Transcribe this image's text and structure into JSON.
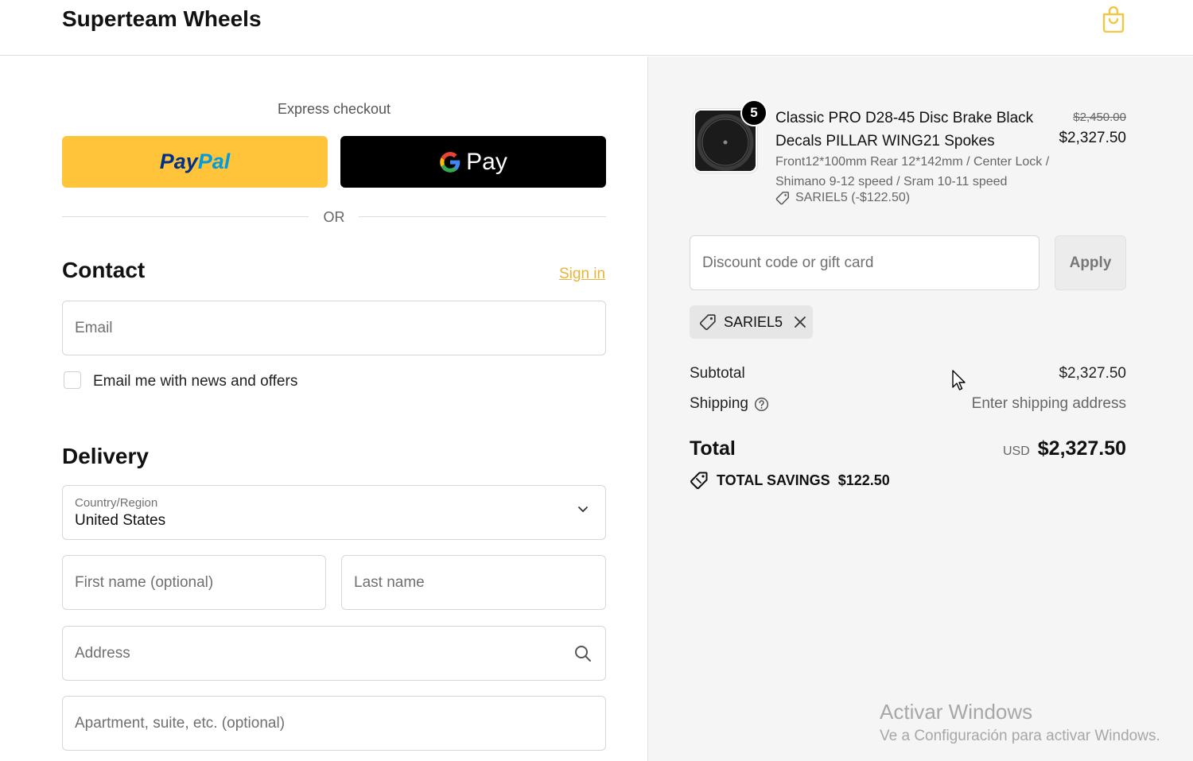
{
  "header": {
    "shop_name": "Superteam Wheels",
    "cart_icon": "shopping-bag-icon",
    "accent_color": "#f2c744"
  },
  "express": {
    "title": "Express checkout",
    "paypal": {
      "label_pay": "Pay",
      "label_pal": "Pal",
      "color": "#ffc43a"
    },
    "gpay": {
      "label": "Pay",
      "color": "#000000"
    },
    "or_label": "OR"
  },
  "contact": {
    "title": "Contact",
    "sign_in": "Sign in",
    "email_placeholder": "Email",
    "newsletter_label": "Email me with news and offers",
    "newsletter_checked": false
  },
  "delivery": {
    "title": "Delivery",
    "country_label": "Country/Region",
    "country_value": "United States",
    "first_name_placeholder": "First name (optional)",
    "last_name_placeholder": "Last name",
    "address_placeholder": "Address",
    "apartment_placeholder": "Apartment, suite, etc. (optional)"
  },
  "order": {
    "item": {
      "quantity": "5",
      "title": "Classic PRO D28-45 Disc Brake Black Decals PILLAR WING21 Spokes",
      "variant": "Front12*100mm Rear 12*142mm / Center Lock / Shimano 9-12 speed / Sram 10-11 speed",
      "discount": "SARIEL5 (-$122.50)",
      "original_price": "$2,450.00",
      "price": "$2,327.50"
    },
    "discount_placeholder": "Discount code or gift card",
    "apply_label": "Apply",
    "applied_code": "SARIEL5",
    "subtotal_label": "Subtotal",
    "subtotal_value": "$2,327.50",
    "shipping_label": "Shipping",
    "shipping_value": "Enter shipping address",
    "total_label": "Total",
    "total_currency": "USD",
    "total_value": "$2,327.50",
    "savings_label": "TOTAL SAVINGS",
    "savings_value": "$122.50"
  },
  "watermark": {
    "title": "Activar Windows",
    "subtitle": "Ve a Configuración para activar Windows."
  }
}
